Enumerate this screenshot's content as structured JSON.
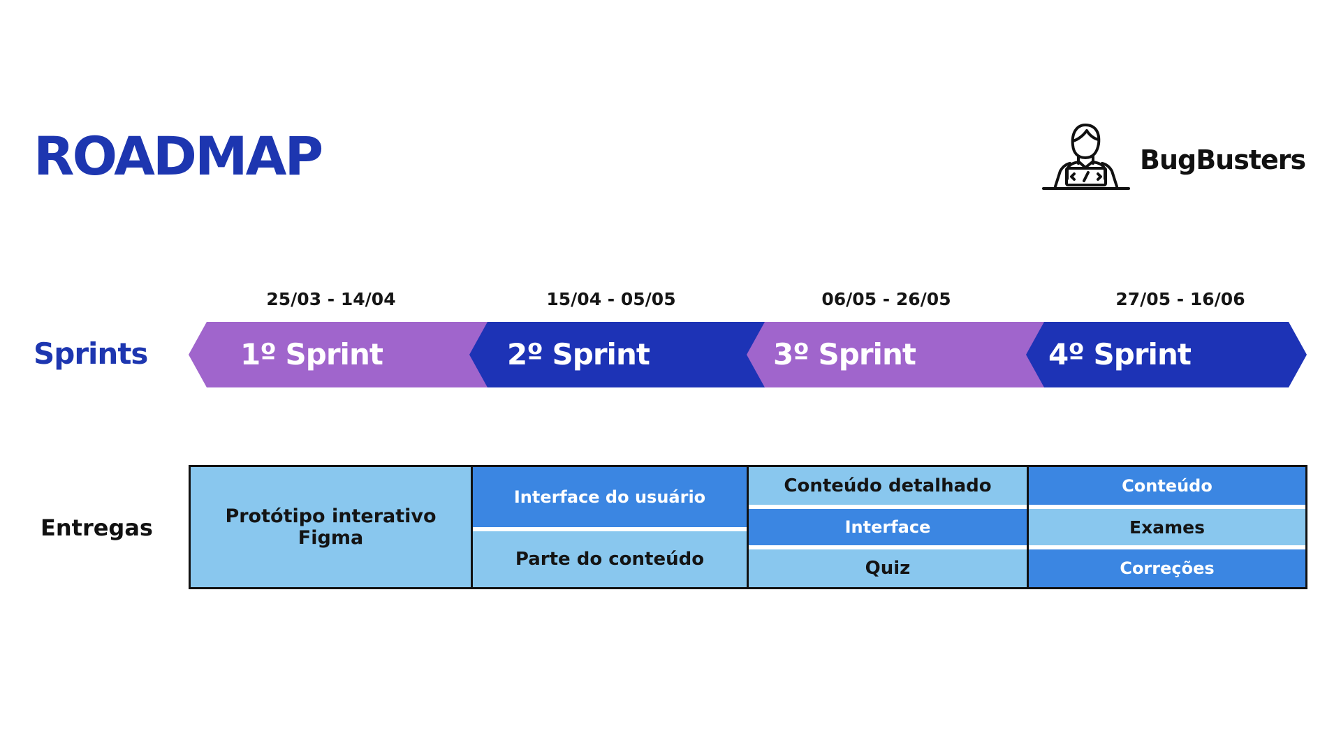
{
  "title": "ROADMAP",
  "brand": {
    "name": "BugBusters",
    "icon": "developer-laptop-icon"
  },
  "rows": {
    "sprints": "Sprints",
    "entregas": "Entregas"
  },
  "colors": {
    "title_blue": "#1d36b0",
    "purple": "#a065cc",
    "navy": "#1d33b6",
    "light_blue": "#89c7ee",
    "mid_blue": "#3b86e2"
  },
  "sprints": [
    {
      "label": "1º Sprint",
      "dates": "25/03 - 14/04"
    },
    {
      "label": "2º Sprint",
      "dates": "15/04 - 05/05"
    },
    {
      "label": "3º Sprint",
      "dates": "06/05 - 26/05"
    },
    {
      "label": "4º Sprint",
      "dates": "27/05 - 16/06"
    }
  ],
  "deliverables": [
    [
      "Protótipo interativo Figma"
    ],
    [
      "Interface do usuário",
      "Parte do conteúdo"
    ],
    [
      "Conteúdo detalhado",
      "Interface",
      "Quiz"
    ],
    [
      "Conteúdo",
      "Exames",
      "Correções"
    ]
  ]
}
